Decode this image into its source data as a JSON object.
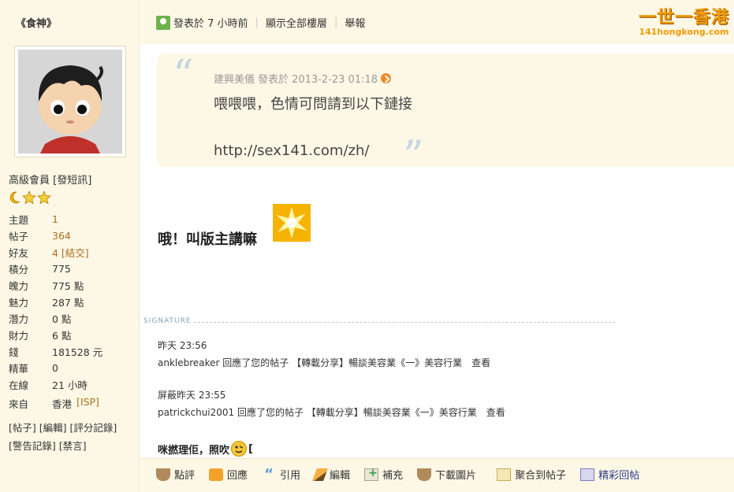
{
  "profile": {
    "username": "《食神》",
    "rank_prefix": "高級會員",
    "rank_link": "[發短訊]",
    "stats": [
      {
        "label": "主題",
        "value": "1",
        "link": true
      },
      {
        "label": "帖子",
        "value": "364",
        "link": true
      },
      {
        "label": "好友",
        "value": "4 [結交]",
        "link": true
      },
      {
        "label": "積分",
        "value": "775",
        "link": false
      },
      {
        "label": "魄力",
        "value": "775 點",
        "link": false
      },
      {
        "label": "魅力",
        "value": "287 點",
        "link": false
      },
      {
        "label": "潛力",
        "value": "0 點",
        "link": false
      },
      {
        "label": "財力",
        "value": "6 點",
        "link": false
      },
      {
        "label": "錢",
        "value": "181528 元",
        "link": false
      },
      {
        "label": "精華",
        "value": "0",
        "link": false
      },
      {
        "label": "在線",
        "value": "21 小時",
        "link": false
      }
    ],
    "from_label": "來自",
    "from_value": "香港",
    "from_link": "[ISP]",
    "links_line1": "[帖子] [編輯] [評分記錄]",
    "links_line2": "[警告記錄] [禁言]"
  },
  "topbar": {
    "posted": "發表於 7 小時前",
    "show_all": "顯示全部樓層",
    "report": "舉報"
  },
  "logo": {
    "main": "一世一香港",
    "sub": "141hongkong.com"
  },
  "quote": {
    "author": "建興美儀",
    "posted_at": "發表於 2013-2-23 01:18",
    "text": "喂喂喂，色情可問請到以下鏈接",
    "url": "http://sex141.com/zh/"
  },
  "post": {
    "body": "哦！叫版主講嘛"
  },
  "signature": {
    "label": "SIGNATURE",
    "entry1_time": "昨天 23:56",
    "entry1_text": "anklebreaker 回應了您的帖子 【轉載分享】暢談美容業《一》美容行業　查看",
    "entry2_time": "屏蔽昨天 23:55",
    "entry2_text": "patrickchui2001 回應了您的帖子 【轉載分享】暢談美容業《一》美容行業　查看",
    "entry3_text": "咪撚理佢，照吹",
    "entry3_suffix": "["
  },
  "actions": [
    {
      "name": "rate",
      "label": "點評"
    },
    {
      "name": "reply",
      "label": "回應"
    },
    {
      "name": "quote",
      "label": "引用"
    },
    {
      "name": "edit",
      "label": "編輯"
    },
    {
      "name": "supplement",
      "label": "補充"
    },
    {
      "name": "download-images",
      "label": "下載圖片"
    },
    {
      "name": "aggregate",
      "label": "聚合到帖子"
    },
    {
      "name": "featured-reply",
      "label": "精彩回帖"
    }
  ]
}
